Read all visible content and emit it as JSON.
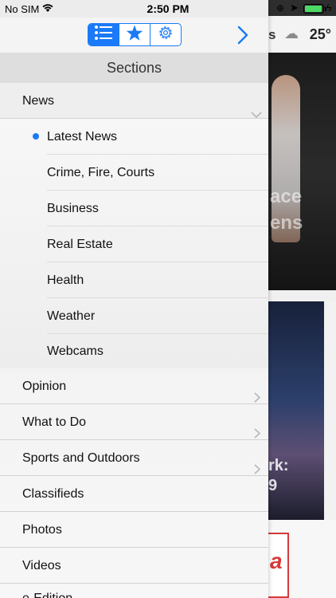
{
  "status_bar": {
    "carrier": "No SIM",
    "time": "2:50 PM"
  },
  "toolbar": {
    "segments": [
      "list-icon",
      "star-icon",
      "gear-icon"
    ],
    "active_segment": 0,
    "forward_icon": "chevron-right-icon",
    "accent_color": "#1a7af7"
  },
  "background_page": {
    "weather_fragment": "s",
    "temperature": "25°",
    "hero_text": [
      "ace",
      "ens"
    ],
    "card_text": [
      "rk:",
      "9"
    ]
  },
  "drawer": {
    "header": "Sections",
    "expanded_section": {
      "label": "News",
      "items": [
        {
          "label": "Latest News",
          "selected": true
        },
        {
          "label": "Crime, Fire, Courts",
          "selected": false
        },
        {
          "label": "Business",
          "selected": false
        },
        {
          "label": "Real Estate",
          "selected": false
        },
        {
          "label": "Health",
          "selected": false
        },
        {
          "label": "Weather",
          "selected": false
        },
        {
          "label": "Webcams",
          "selected": false
        }
      ]
    },
    "sections": [
      {
        "label": "Opinion",
        "has_children": true
      },
      {
        "label": "What to Do",
        "has_children": true
      },
      {
        "label": "Sports and Outdoors",
        "has_children": true
      },
      {
        "label": "Classifieds",
        "has_children": false
      },
      {
        "label": "Photos",
        "has_children": false
      },
      {
        "label": "Videos",
        "has_children": false
      },
      {
        "label": "e-Edition",
        "has_children": false
      }
    ]
  }
}
